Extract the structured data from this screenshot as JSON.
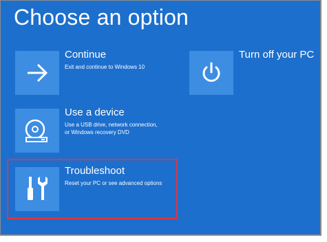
{
  "screen": {
    "title": "Choose an option",
    "background_color": "#1d6fcd",
    "tile_color": "#3d8de2",
    "highlight_color": "#e8333b"
  },
  "options": [
    {
      "id": "continue",
      "icon": "arrow-right-icon",
      "label": "Continue",
      "description": "Exit and continue to Windows 10"
    },
    {
      "id": "use-device",
      "icon": "disc-drive-icon",
      "label": "Use a device",
      "description_lines": [
        "Use a USB drive, network connection,",
        "or Windows recovery DVD"
      ]
    },
    {
      "id": "troubleshoot",
      "icon": "tools-icon",
      "label": "Troubleshoot",
      "description": "Reset your PC or see advanced options",
      "highlighted": true
    },
    {
      "id": "turn-off",
      "icon": "power-icon",
      "label": "Turn off your PC"
    }
  ]
}
